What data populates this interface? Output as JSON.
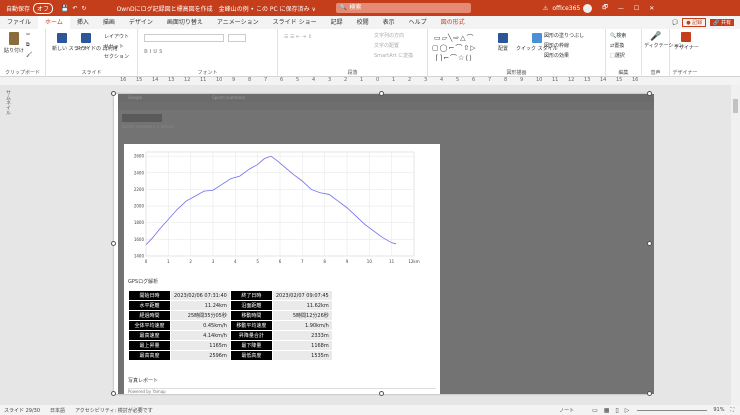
{
  "titlebar": {
    "autosave": "自動保存",
    "autosave_state": "オフ",
    "doc_title": "OwnDにログ記録図と標高図を作成　金峰山の例 • この PC に保存済み ∨",
    "search": "検索",
    "account": "office365",
    "buttons": [
      "🗗",
      "—",
      "☐",
      "✕"
    ]
  },
  "tabs": [
    "ファイル",
    "ホーム",
    "挿入",
    "描画",
    "デザイン",
    "画面切り替え",
    "アニメーション",
    "スライド ショー",
    "記録",
    "校閲",
    "表示",
    "ヘルプ",
    "図の形式"
  ],
  "tabs_right": {
    "record": "● 記録",
    "share": "🔗 共有"
  },
  "ribbon": {
    "clipboard": {
      "paste": "貼り付け",
      "label": "クリップボード"
    },
    "slides": {
      "new": "新しい スライド",
      "reuse": "スライドの 再利用",
      "layout": "レイアウト",
      "reset": "リセット",
      "section": "セクション",
      "label": "スライド"
    },
    "font": {
      "label": "フォント"
    },
    "paragraph": {
      "label": "段落",
      "direction": "文字列の方向",
      "align": "文字の配置",
      "smartart": "SmartArt に変換"
    },
    "drawing": {
      "arrange": "配置",
      "quickstyle": "クイック スタイル",
      "fill": "図形の塗りつぶし",
      "outline": "図形の枠線",
      "effect": "図形の効果",
      "label": "図形描画"
    },
    "editing": {
      "find": "検索",
      "replace": "置換",
      "select": "選択",
      "label": "編集"
    },
    "voice": {
      "dictate": "ディクテーション",
      "label": "音声"
    },
    "designer": {
      "label": "デザイナー",
      "btn": "デザイナー"
    }
  },
  "ruler": {
    "marks": [
      "16",
      "15",
      "14",
      "13",
      "12",
      "11",
      "10",
      "9",
      "8",
      "7",
      "6",
      "5",
      "4",
      "3",
      "2",
      "1",
      "0",
      "1",
      "2",
      "3",
      "4",
      "5",
      "6",
      "7",
      "8",
      "9",
      "10",
      "11",
      "12",
      "13",
      "14",
      "15",
      "16"
    ]
  },
  "thumbnails_label": "サムネイル",
  "browser": {
    "addr_text": "Google",
    "page_title": "Sports summary",
    "crumbs": "Sports summary > details"
  },
  "chart_data": {
    "type": "line",
    "x_ticks": [
      "0",
      "1",
      "2",
      "3",
      "4",
      "5",
      "6",
      "7",
      "8",
      "9",
      "10",
      "11",
      "12km"
    ],
    "y_ticks": [
      "1400",
      "1600",
      "1800",
      "2000",
      "2200",
      "2400",
      "2600"
    ],
    "ylim": [
      1400,
      2650
    ],
    "xlim": [
      0,
      12
    ],
    "x": [
      0,
      0.3,
      0.6,
      1,
      1.4,
      1.8,
      2.2,
      2.6,
      3,
      3.4,
      3.8,
      4.2,
      4.6,
      5,
      5.3,
      5.6,
      5.9,
      6.2,
      6.6,
      7,
      7.4,
      7.8,
      8.2,
      8.6,
      9,
      9.4,
      9.8,
      10.2,
      10.6,
      11,
      11.2
    ],
    "y": [
      1535,
      1620,
      1720,
      1840,
      1960,
      2060,
      2120,
      2180,
      2190,
      2260,
      2330,
      2360,
      2440,
      2500,
      2570,
      2600,
      2540,
      2470,
      2380,
      2300,
      2200,
      2160,
      2140,
      2060,
      1980,
      1880,
      1780,
      1700,
      1620,
      1560,
      1545
    ]
  },
  "gps_title": "GPSログ解析",
  "stats": [
    {
      "l1": "開始日時",
      "v1": "2023/02/06 07:31:40",
      "l2": "終了日時",
      "v2": "2023/02/07 09:07:45"
    },
    {
      "l1": "水平距離",
      "v1": "11.24km",
      "l2": "沿面距離",
      "v2": "11.62km"
    },
    {
      "l1": "経過時間",
      "v1": "25時間35分05秒",
      "l2": "移動時間",
      "v2": "5時間12分26秒"
    },
    {
      "l1": "全体平均速度",
      "v1": "0.45km/h",
      "l2": "移動平均速度",
      "v2": "1.90km/h"
    },
    {
      "l1": "最高速度",
      "v1": "4.14km/h",
      "l2": "昇降量合計",
      "v2": "2333m"
    },
    {
      "l1": "最上昇量",
      "v1": "1165m",
      "l2": "最下降量",
      "v2": "1168m"
    },
    {
      "l1": "最高高度",
      "v1": "2596m",
      "l2": "最低高度",
      "v2": "1535m"
    }
  ],
  "photo_report": "写真レポート",
  "powered": "Powered by Yamap",
  "status": {
    "slide": "スライド 29/30",
    "lang": "日本語",
    "access": "アクセシビリティ: 検討が必要です",
    "notes": "ノート",
    "zoom": "91%"
  }
}
